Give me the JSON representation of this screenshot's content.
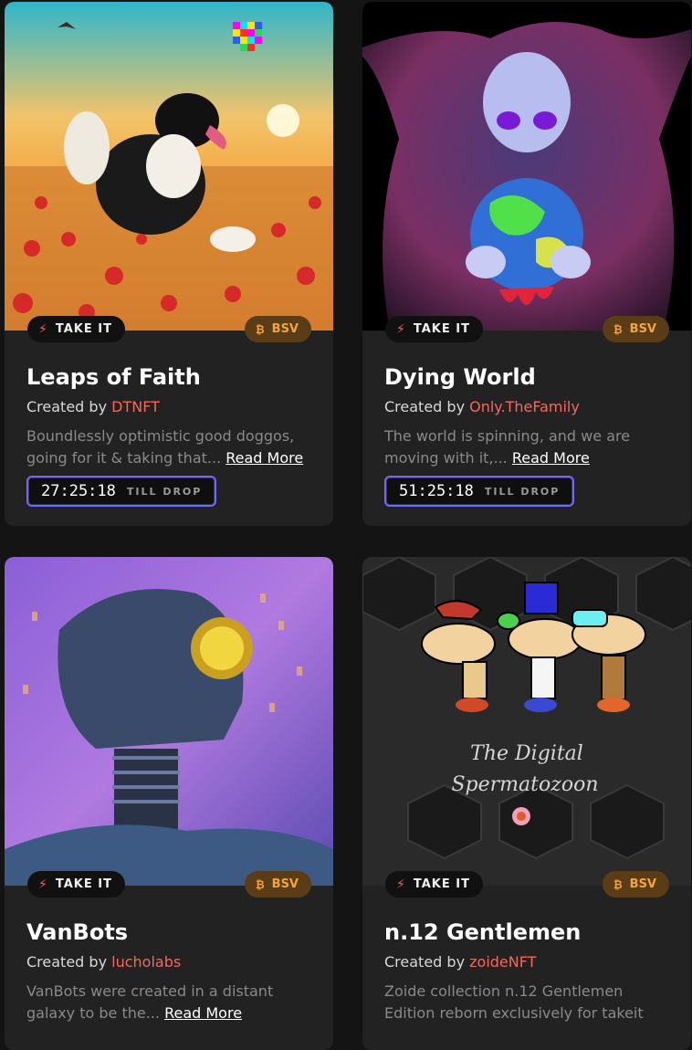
{
  "cards": [
    {
      "take_label": "TAKE IT",
      "currency": "BSV",
      "title": "Leaps of Faith",
      "created_by": "Created by",
      "creator": "DTNFT",
      "description": "Boundlessly optimistic good doggos, going for it & taking that...",
      "read_more": "Read More",
      "timer": "27:25:18",
      "till_drop": "TILL DROP"
    },
    {
      "take_label": "TAKE IT",
      "currency": "BSV",
      "title": "Dying World",
      "created_by": "Created by",
      "creator": "Only.TheFamily",
      "description": "The world is spinning, and we are moving with it,...",
      "read_more": "Read More",
      "timer": "51:25:18",
      "till_drop": "TILL DROP"
    },
    {
      "take_label": "TAKE IT",
      "currency": "BSV",
      "title": "VanBots",
      "created_by": "Created by",
      "creator": "lucholabs",
      "description": "VanBots were created in a distant galaxy to be the...",
      "read_more": "Read More"
    },
    {
      "take_label": "TAKE IT",
      "currency": "BSV",
      "title": "n.12 Gentlemen",
      "created_by": "Created by",
      "creator": "zoideNFT",
      "description": "Zoide collection n.12 Gentlemen Edition reborn exclusively for takeit",
      "art_text_line1": "The Digital",
      "art_text_line2": "Spermatozoon"
    }
  ],
  "colors": {
    "background": "#141414",
    "card": "#222222",
    "creator": "#f06a5f",
    "bsv_text": "#f6a43a",
    "bsv_bg": "#5a3d16",
    "timer_border": "#7b63ff"
  },
  "icons": [
    "lightning-icon",
    "bitcoin-icon"
  ]
}
